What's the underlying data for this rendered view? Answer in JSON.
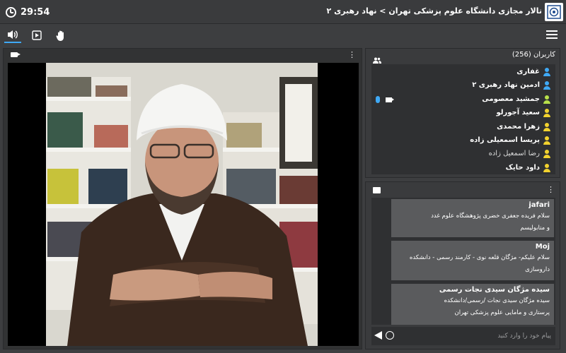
{
  "header": {
    "timer": "29:54",
    "title": "تالار مجازی دانشگاه علوم پزشکی تهران > نهاد رهبری ۲"
  },
  "colors": {
    "accent": "#3fa9f5",
    "moderator": "#3fa9f5",
    "presenter": "#f2d22e",
    "viewer": "#b8e04a",
    "panel": "#3a3b3d",
    "panel_inner": "#2f3032",
    "message": "#5a5b5d"
  },
  "toolbar": {
    "speaker": "speaker-icon",
    "play": "play-icon",
    "hand": "raise-hand-icon",
    "menu": "hamburger-icon"
  },
  "users": {
    "title": "کاربران (256)",
    "items": [
      {
        "name": "غفاری",
        "role": "moderator"
      },
      {
        "name": "ادمین نهاد رهبری ۲",
        "role": "moderator"
      },
      {
        "name": "جمشید معصومی",
        "role": "viewer",
        "mic": true,
        "camera": true
      },
      {
        "name": "سعید آجورلو",
        "role": "presenter"
      },
      {
        "name": "زهرا محمدی",
        "role": "presenter"
      },
      {
        "name": "پریسا اسمعیلی زاده",
        "role": "presenter"
      },
      {
        "name": "رضا اسمعیل زاده",
        "role": "presenter"
      },
      {
        "name": "داود حایک",
        "role": "presenter"
      }
    ]
  },
  "chat": {
    "messages": [
      {
        "sender": "jafari",
        "lines": [
          "سلام فریده جعفری خضری         پژوهشگاه علوم غدد",
          "و متابولیسم"
        ]
      },
      {
        "sender": "Moj",
        "lines": [
          "سلام علیکم- مژگان قلعه نوی - کارمند رسمی - دانشکده",
          "داروسازی"
        ]
      },
      {
        "sender": "سیده مژگان سیدی نجات رسمی",
        "lines": [
          "سیده مژگان سیدی نجات                  /رسمی/دانشکده",
          "پرستاری و مامایی علوم پزشکی تهران"
        ]
      }
    ],
    "input_placeholder": "پیام خود را وارد کنید"
  }
}
